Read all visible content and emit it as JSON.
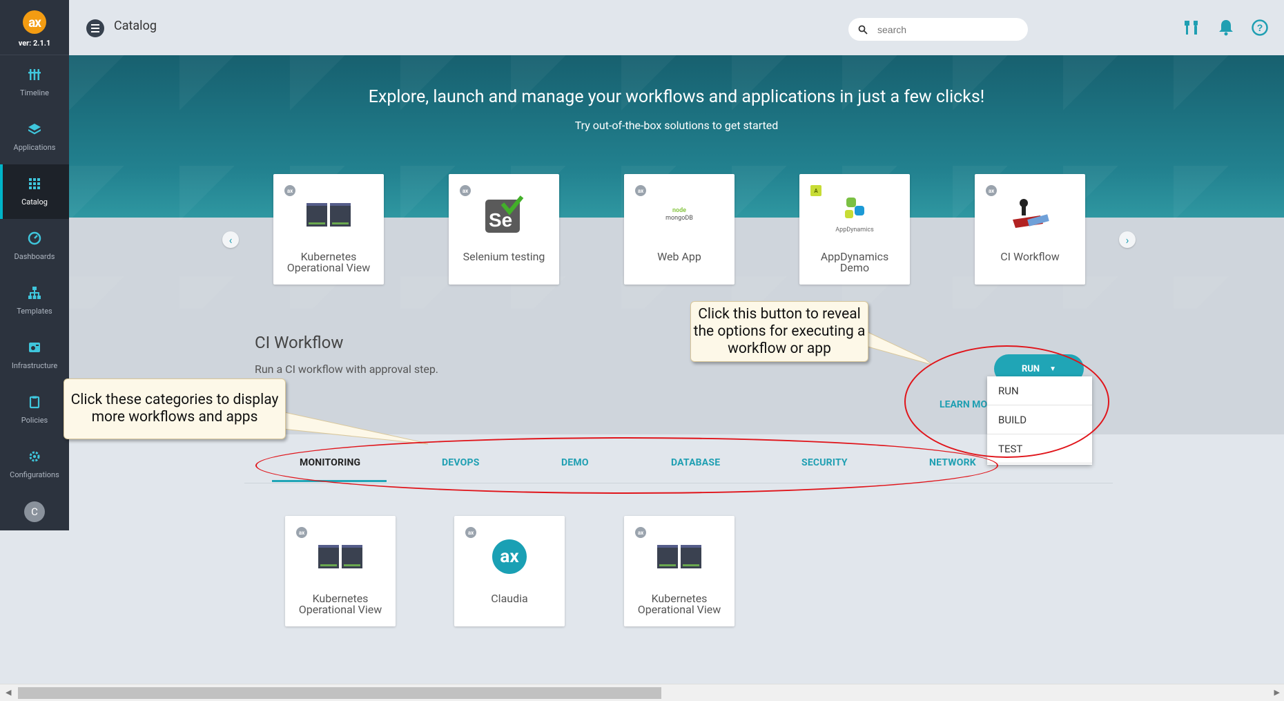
{
  "brand": {
    "logo_text": "ax",
    "version": "ver: 2.1.1"
  },
  "sidebar": {
    "items": [
      {
        "label": "Timeline",
        "icon": "timeline-icon"
      },
      {
        "label": "Applications",
        "icon": "applications-icon"
      },
      {
        "label": "Catalog",
        "icon": "catalog-icon",
        "active": true
      },
      {
        "label": "Dashboards",
        "icon": "dashboards-icon"
      },
      {
        "label": "Templates",
        "icon": "templates-icon"
      },
      {
        "label": "Infrastructure",
        "icon": "infrastructure-icon"
      },
      {
        "label": "Policies",
        "icon": "policies-icon"
      },
      {
        "label": "Configurations",
        "icon": "configurations-icon"
      }
    ],
    "avatar_initial": "C"
  },
  "header": {
    "title": "Catalog",
    "search_placeholder": "search",
    "icons": [
      "tools-icon",
      "bell-icon",
      "help-icon"
    ]
  },
  "hero": {
    "title": "Explore, launch and manage your workflows and applications in just a few clicks!",
    "subtitle": "Try out-of-the-box solutions to get started"
  },
  "carousel": {
    "cards": [
      {
        "label": "Kubernetes Operational View",
        "badge": "ax"
      },
      {
        "label": "Selenium testing",
        "badge": "ax"
      },
      {
        "label": "Web App",
        "badge": "ax"
      },
      {
        "label": "AppDynamics Demo",
        "badge": "A"
      },
      {
        "label": "CI Workflow",
        "badge": "ax"
      }
    ],
    "webapp_logo_line1": "node",
    "webapp_logo_line2": "mongoDB",
    "appdynamics_logo": "AppDynamics"
  },
  "detail": {
    "title": "CI Workflow",
    "description": "Run a CI workflow with approval step.",
    "run_label": "RUN",
    "learn_more": "LEARN MO",
    "dropdown": [
      "RUN",
      "BUILD",
      "TEST"
    ]
  },
  "tabs": [
    "MONITORING",
    "DEVOPS",
    "DEMO",
    "DATABASE",
    "SECURITY",
    "NETWORK"
  ],
  "grid": {
    "cards": [
      {
        "label": "Kubernetes Operational View",
        "badge": "ax"
      },
      {
        "label": "Claudia",
        "badge": "ax",
        "logo_text": "ax"
      },
      {
        "label": "Kubernetes Operational View",
        "badge": "ax"
      }
    ]
  },
  "callouts": {
    "run": "Click this button to reveal the options for executing a workflow or app",
    "categories": "Click these categories to display more workflows and apps"
  },
  "colors": {
    "accent": "#20a5b6",
    "sidebar": "#2c333e",
    "annotation": "#e0141a"
  }
}
